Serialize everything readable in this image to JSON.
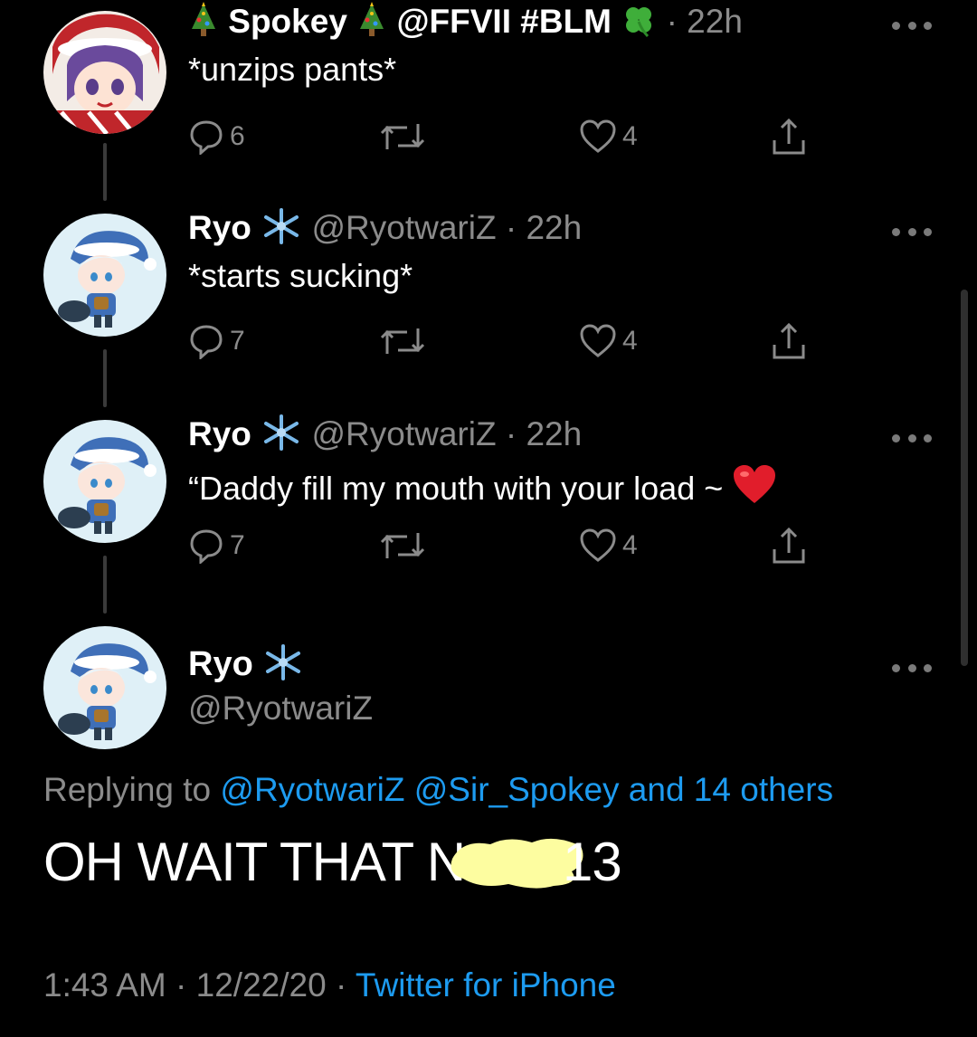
{
  "tweets": [
    {
      "name": "Spokey",
      "handle_text": "@FFVII #BLM",
      "time": "22h",
      "text": "*unzips pants*",
      "replies": "6",
      "likes": "4",
      "name_emojis": [
        "christmas-tree",
        "christmas-tree",
        "four-leaf-clover"
      ]
    },
    {
      "name": "Ryo",
      "handle_text": "@RyotwariZ",
      "time": "22h",
      "text": "*starts sucking*",
      "replies": "7",
      "likes": "4",
      "name_emojis": [
        "snowflake"
      ]
    },
    {
      "name": "Ryo",
      "handle_text": "@RyotwariZ",
      "time": "22h",
      "text": "“Daddy fill my mouth with your load ~",
      "text_emoji": "red-heart",
      "replies": "7",
      "likes": "4",
      "name_emojis": [
        "snowflake"
      ]
    }
  ],
  "main": {
    "name": "Ryo",
    "handle": "@RyotwariZ",
    "replying_prefix": "Replying to",
    "replying_mentions": "@RyotwariZ @Sir_Spokey and 14 others",
    "text_before": "OH WAIT THAT N",
    "text_after": "13",
    "time": "1:43 AM",
    "date": "12/22/20",
    "source": "Twitter for iPhone"
  },
  "separator": "·",
  "colors": {
    "background": "#000000",
    "secondary_text": "#8b8b8b",
    "link": "#1d9bf0",
    "redaction": "#fdfda0"
  },
  "icons": [
    "reply-icon",
    "retweet-icon",
    "like-icon",
    "share-icon",
    "more-icon"
  ]
}
